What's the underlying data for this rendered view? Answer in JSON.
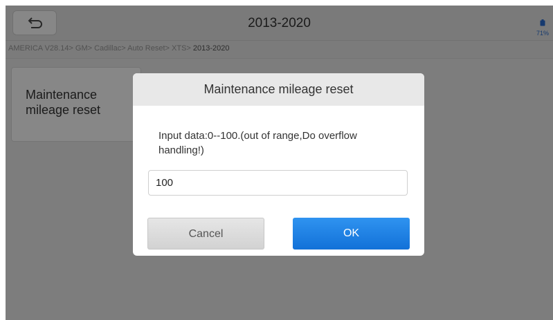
{
  "header": {
    "title": "2013-2020",
    "battery": "71%"
  },
  "breadcrumb": {
    "path": "AMERICA V28.14> GM> Cadillac> Auto Reset> XTS> ",
    "current": "2013-2020"
  },
  "function_list": [
    {
      "label": "Maintenance mileage reset"
    }
  ],
  "dialog": {
    "title": "Maintenance mileage reset",
    "message": "Input data:0--100.(out of range,Do overflow handling!)",
    "input_value": "100",
    "cancel_label": "Cancel",
    "ok_label": "OK"
  },
  "colors": {
    "accent": "#1A7FE3",
    "overlay": "rgba(0,0,0,0.47)"
  }
}
